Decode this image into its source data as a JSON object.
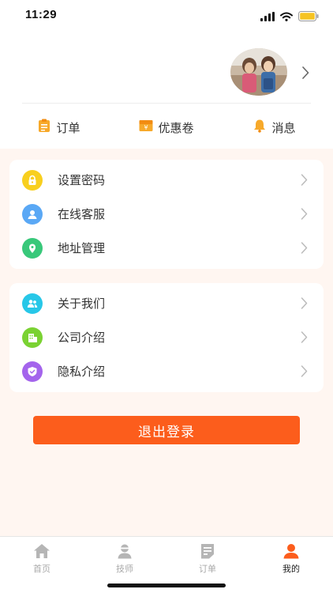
{
  "status": {
    "time": "11:29"
  },
  "shortcuts": [
    {
      "label": "订单",
      "icon": "order-clipboard-icon"
    },
    {
      "label": "优惠卷",
      "icon": "coupon-icon"
    },
    {
      "label": "消息",
      "icon": "bell-icon"
    }
  ],
  "menu_group1": [
    {
      "label": "设置密码",
      "icon": "lock-icon",
      "color": "#f8cf1e"
    },
    {
      "label": "在线客服",
      "icon": "customer-service-icon",
      "color": "#5aa8f5"
    },
    {
      "label": "地址管理",
      "icon": "location-pin-icon",
      "color": "#38c87a"
    }
  ],
  "menu_group2": [
    {
      "label": "关于我们",
      "icon": "users-icon",
      "color": "#27c7e8"
    },
    {
      "label": "公司介绍",
      "icon": "building-icon",
      "color": "#7ad232"
    },
    {
      "label": "隐私介绍",
      "icon": "shield-check-icon",
      "color": "#a464ec"
    }
  ],
  "logout_label": "退出登录",
  "tabs": [
    {
      "label": "首页",
      "icon": "home-icon",
      "active": false
    },
    {
      "label": "技师",
      "icon": "technician-icon",
      "active": false
    },
    {
      "label": "订单",
      "icon": "document-icon",
      "active": false
    },
    {
      "label": "我的",
      "icon": "user-icon",
      "active": true
    }
  ],
  "colors": {
    "accent": "#fc5d1c",
    "background": "#fff6f1",
    "tab_inactive": "#aaaaaa"
  }
}
